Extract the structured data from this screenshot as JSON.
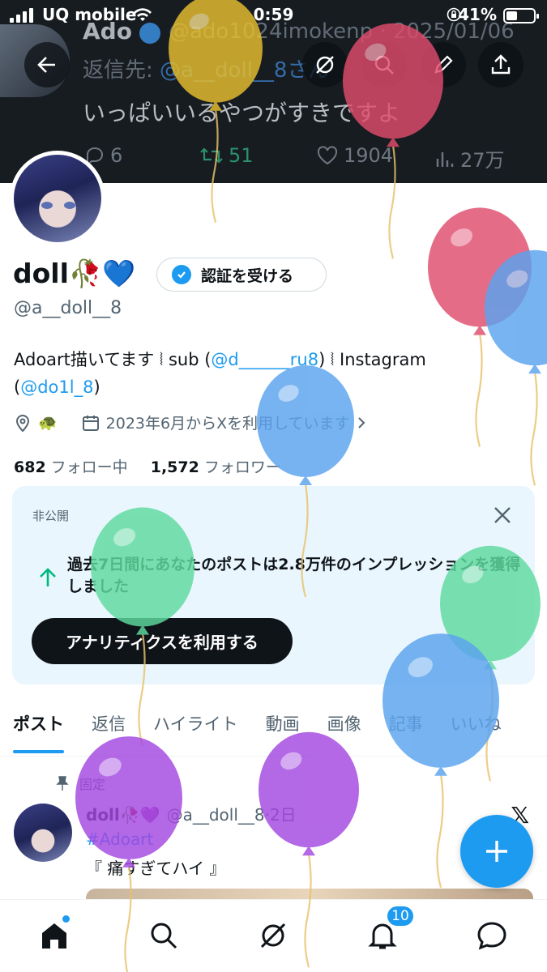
{
  "status_bar": {
    "carrier": "UQ mobile",
    "time": "0:59",
    "battery_pct": "41%",
    "battery_level": 0.41
  },
  "banner_tweet": {
    "name": "Ado",
    "handle": "@ado1024imokenp · 2025/01/06",
    "reply_prefix": "返信先: ",
    "reply_to": "@a__doll__8さん",
    "body": "いっぱいいるやつがすきですよ",
    "replies": "6",
    "retweets": "51",
    "likes": "1904",
    "views": "27万"
  },
  "profile": {
    "display_name": "doll🥀💙",
    "verify_button": "認証を受ける",
    "handle": "@a__doll__8",
    "bio_prefix": "Adoart描いてます ⦚ sub (",
    "bio_link1": "@d______ru8",
    "bio_mid": ") ⦚ Instagram",
    "bio_open": "(",
    "bio_link2": "@do1l_8",
    "bio_close": ")",
    "location_emoji": "🐢",
    "joined": "2023年6月からXを利用しています",
    "following_count": "682",
    "following_label": "フォロー中",
    "followers_count": "1,572",
    "followers_label": "フォロワー"
  },
  "analytics_card": {
    "label": "非公開",
    "text": "過去7日間にあなたのポストは2.8万件のインプレッションを獲得しました",
    "cta": "アナリティクスを利用する"
  },
  "tabs": [
    "ポスト",
    "返信",
    "ハイライト",
    "動画",
    "画像",
    "記事",
    "いいね"
  ],
  "active_tab": 0,
  "pinned_post": {
    "pinned_label": "固定",
    "name": "doll🥀💜",
    "handle_time": "@a__doll__8·2日",
    "hashtag": "#Adoart",
    "text": "『 痛すぎてハイ 』"
  },
  "bottom_nav": {
    "notifications_badge": "10"
  },
  "icons": {
    "back": "arrow-left-icon",
    "grok": "grok-icon",
    "search": "search-icon",
    "edit": "pen-icon",
    "share": "share-icon",
    "home": "home-icon",
    "explore": "search-icon",
    "notifications": "bell-icon",
    "messages": "chat-bubble-icon",
    "compose": "plus-icon"
  },
  "colors": {
    "accent": "#1d9bf0",
    "balloon_yellow": "#e8c02f",
    "balloon_red": "#e04c6c",
    "balloon_blue": "#5aa3ef",
    "balloon_green": "#5fdb9f",
    "balloon_purple": "#a347e0"
  }
}
